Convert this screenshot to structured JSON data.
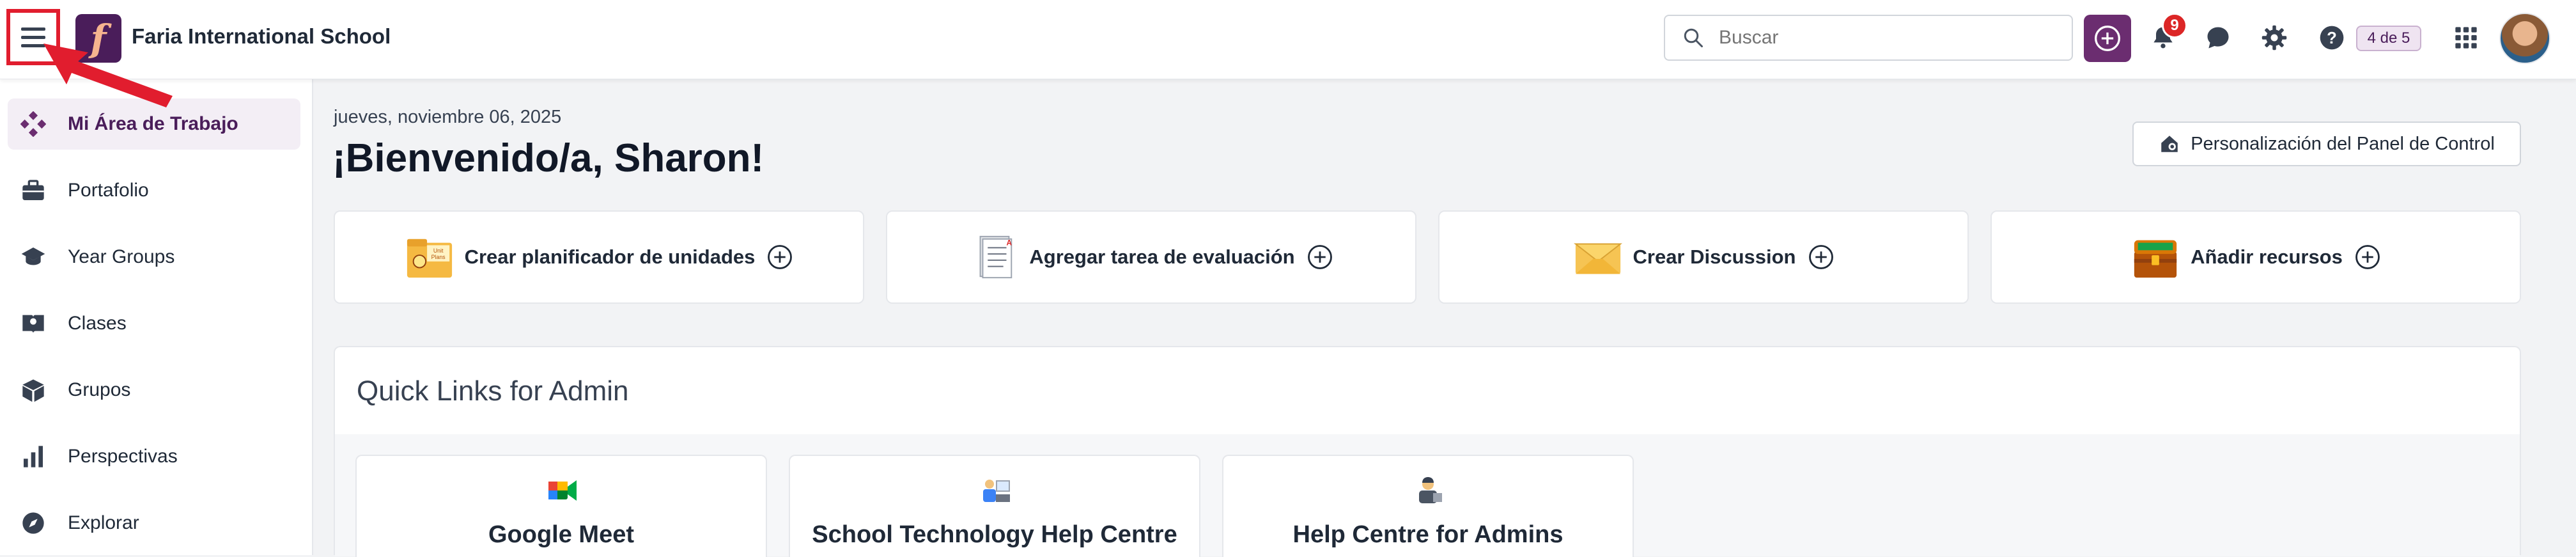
{
  "header": {
    "school_name": "Faria International School",
    "search_placeholder": "Buscar",
    "notification_count": "9",
    "pager": "4 de 5"
  },
  "sidebar": {
    "items": [
      {
        "label": "Mi Área de Trabajo",
        "icon": "workspace-icon",
        "active": true
      },
      {
        "label": "Portafolio",
        "icon": "briefcase-icon"
      },
      {
        "label": "Year Groups",
        "icon": "graduation-cap-icon"
      },
      {
        "label": "Clases",
        "icon": "class-book-icon"
      },
      {
        "label": "Grupos",
        "icon": "cube-icon"
      },
      {
        "label": "Perspectivas",
        "icon": "bar-chart-icon"
      },
      {
        "label": "Explorar",
        "icon": "compass-icon"
      }
    ]
  },
  "main": {
    "date": "jueves, noviembre 06, 2025",
    "welcome": "¡Bienvenido/a, Sharon!",
    "customize_label": "Personalización del Panel de Control",
    "actions": [
      {
        "label": "Crear planificador de unidades",
        "icon": "unit-planner-icon"
      },
      {
        "label": "Agregar tarea de evaluación",
        "icon": "assessment-icon"
      },
      {
        "label": "Crear Discussion",
        "icon": "envelope-icon"
      },
      {
        "label": "Añadir recursos",
        "icon": "treasure-chest-icon"
      }
    ],
    "quick_links": {
      "title": "Quick Links for Admin",
      "items": [
        {
          "label": "Google Meet",
          "icon": "google-meet-icon"
        },
        {
          "label": "School Technology Help Centre",
          "icon": "tech-help-icon"
        },
        {
          "label": "Help Centre for Admins",
          "icon": "admin-help-icon"
        }
      ]
    }
  },
  "colors": {
    "brand": "#4a1d5a",
    "accent_button": "#6b2d70",
    "highlight_box": "#e11d2e",
    "badge": "#dc2626"
  }
}
